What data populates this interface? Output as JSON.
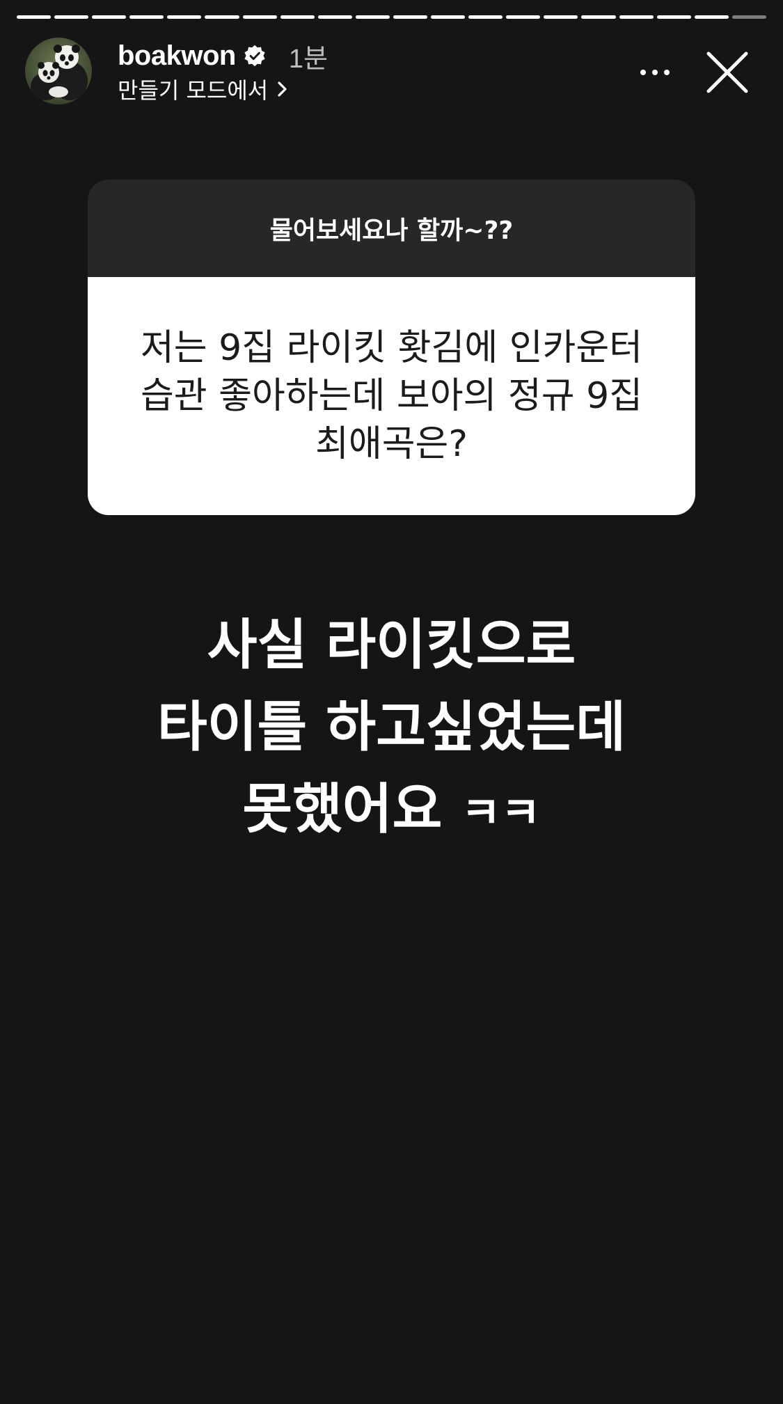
{
  "story": {
    "progress_segments": 20,
    "active_segments": 19
  },
  "header": {
    "avatar_icon": "panda-avatar",
    "username": "boakwon",
    "verified_icon": "verified-badge-icon",
    "time": "1분",
    "mode_label": "만들기 모드에서",
    "mode_chevron": "chevron-right-icon",
    "more_icon": "more-horizontal-icon",
    "close_icon": "close-icon"
  },
  "question": {
    "prompt": "물어보세요나 할까~??",
    "text_lines": [
      "저는 9집 라이킷 홧김에 인카운터",
      "습관 좋아하는데 보아의 정규 9집",
      "최애곡은?"
    ],
    "header_color": "#272727",
    "body_color": "#ffffff"
  },
  "answer": {
    "lines": [
      "사실 라이킷으로",
      "타이틀 하고싶었는데",
      "못했어요"
    ],
    "suffix": "ㅋㅋ"
  },
  "colors": {
    "background": "#151515",
    "text": "#ffffff"
  }
}
